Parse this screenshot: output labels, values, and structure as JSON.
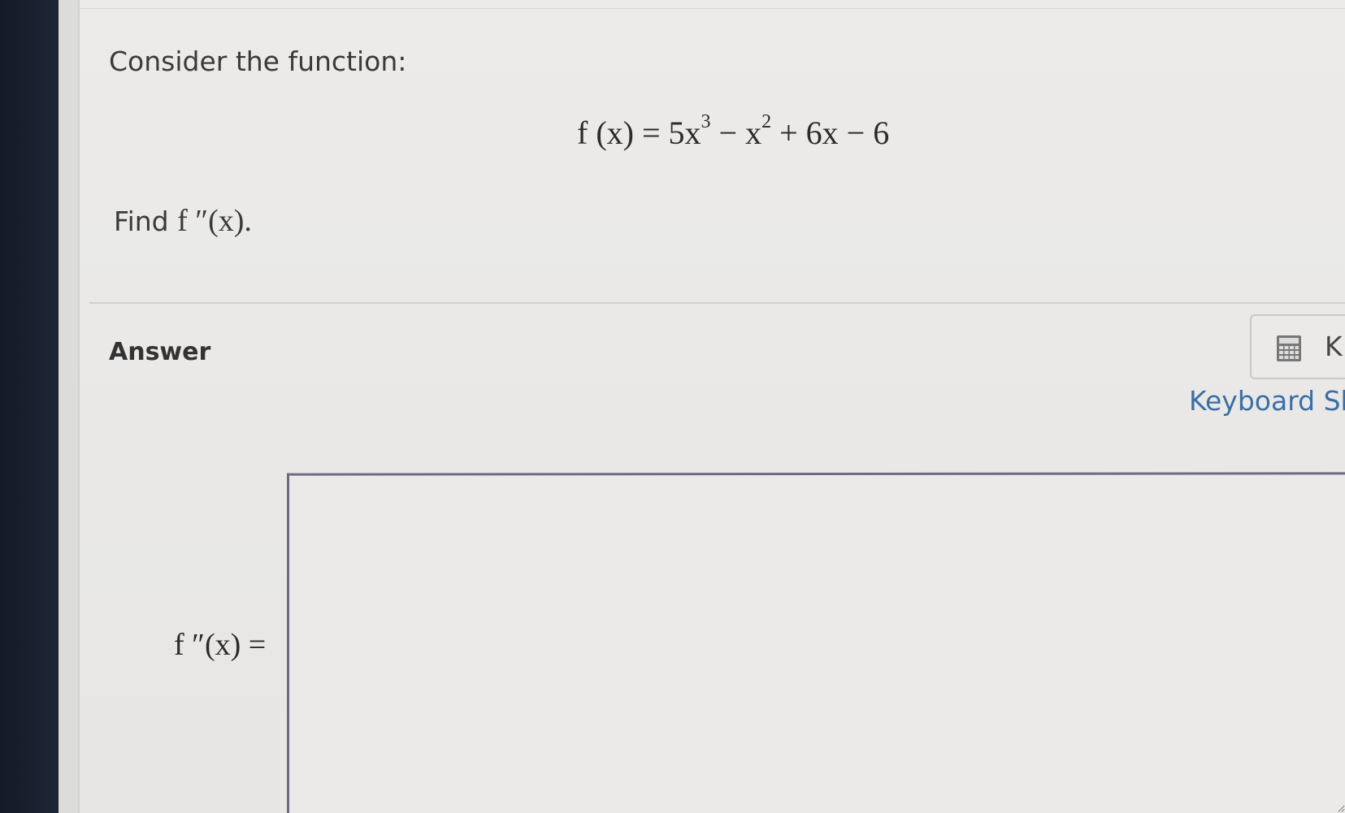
{
  "question": {
    "intro": "Consider the function:",
    "equation": {
      "lhs": "f (x) = 5x",
      "exp1": "3",
      "mid": " − x",
      "exp2": "2",
      "rhs": " + 6x − 6"
    },
    "prompt_text": "Find ",
    "prompt_math": "f ″(x)."
  },
  "answer": {
    "heading": "Answer",
    "calculator_icon": "calculator-icon",
    "calculator_label": "K",
    "shortcuts_link": "Keyboard Sh",
    "input_label": "f ″(x) =",
    "input_value": ""
  }
}
